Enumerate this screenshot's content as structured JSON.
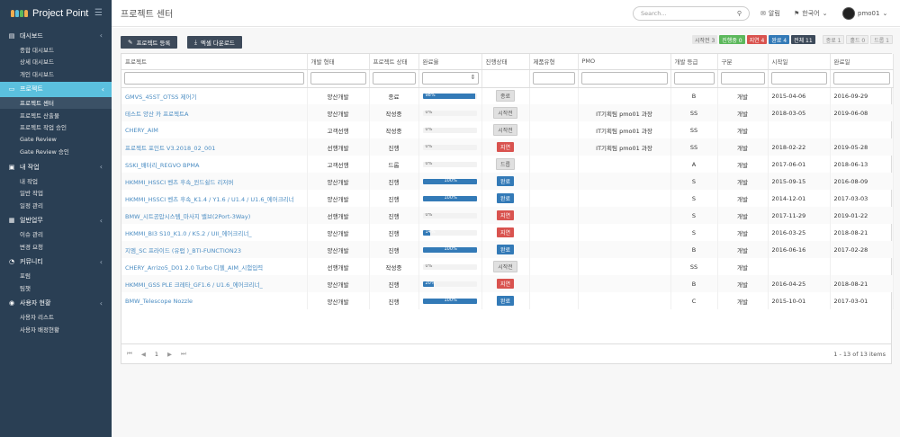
{
  "app": {
    "title": "Project Point"
  },
  "sidebar": {
    "sections": [
      {
        "label": "대시보드",
        "icon": "bar-chart-icon",
        "items": [
          "종합 대시보드",
          "상세 대시보드",
          "개인 대시보드"
        ]
      },
      {
        "label": "프로젝트",
        "icon": "monitor-icon",
        "items": [
          "프로젝트 센터",
          "프로젝트 산출물",
          "프로젝트 작업 승인",
          "Gate Review",
          "Gate Review 승인"
        ]
      },
      {
        "label": "내 작업",
        "icon": "briefcase-icon",
        "items": [
          "내 작업",
          "일반 작업",
          "일정 관리"
        ]
      },
      {
        "label": "일반업무",
        "icon": "calendar-icon",
        "items": [
          "이슈 관리",
          "변경 요청"
        ]
      },
      {
        "label": "커뮤니티",
        "icon": "chat-icon",
        "items": [
          "포럼",
          "팀챗"
        ]
      },
      {
        "label": "사용자 현황",
        "icon": "users-icon",
        "items": [
          "사용자 리스트",
          "사용자 배정현황"
        ]
      }
    ]
  },
  "header": {
    "page_title": "프로젝트 센터",
    "search_placeholder": "Search...",
    "notify_label": "알림",
    "language_label": "한국어",
    "user_label": "pmo01"
  },
  "toolbar": {
    "register_label": "프로젝트 등록",
    "excel_label": "엑셀 다운로드"
  },
  "status_badges": [
    {
      "label": "시작전 3",
      "bg": "#e6e6e6",
      "fg": "#666"
    },
    {
      "label": "진행중 0",
      "bg": "#5cb85c",
      "fg": "#fff"
    },
    {
      "label": "지연 4",
      "bg": "#d9534f",
      "fg": "#fff"
    },
    {
      "label": "완료 4",
      "bg": "#337ab7",
      "fg": "#fff"
    },
    {
      "label": "전체 11",
      "bg": "#3d4a5a",
      "fg": "#fff"
    }
  ],
  "gate_badges": [
    "종료 1",
    "홀드 0",
    "드롭 1"
  ],
  "columns": [
    "프로젝트",
    "개발 형태",
    "프로젝트 상태",
    "완료율",
    "진행상태",
    "제품유형",
    "PMO",
    "개발 등급",
    "구분",
    "시작일",
    "완료일"
  ],
  "rows": [
    {
      "name": "GMVS_45ST_OTSS 제어기",
      "dev": "양산개발",
      "pstate": "종료",
      "pct": 98,
      "status": "종료",
      "status_color": "gray",
      "pmo": "",
      "grade": "B",
      "type": "개발",
      "start": "2015-04-06",
      "end": "2016-09-29"
    },
    {
      "name": "테스트 양산 카 프로젝트A",
      "dev": "양산개발",
      "pstate": "작성중",
      "pct": 0,
      "status": "시작전",
      "status_color": "gray",
      "pmo": "IT기획팀 pmo01 과장",
      "grade": "SS",
      "type": "개발",
      "start": "2018-03-05",
      "end": "2019-06-08"
    },
    {
      "name": "CHERY_AIM",
      "dev": "고객선행",
      "pstate": "작성중",
      "pct": 0,
      "status": "시작전",
      "status_color": "gray",
      "pmo": "IT기획팀 pmo01 과장",
      "grade": "SS",
      "type": "개발",
      "start": "",
      "end": ""
    },
    {
      "name": "프로젝트 포인트 V3.2018_02_001",
      "dev": "선행개발",
      "pstate": "진행",
      "pct": 0,
      "status": "지연",
      "status_color": "red",
      "pmo": "IT기획팀 pmo01 과장",
      "grade": "SS",
      "type": "개발",
      "start": "2018-02-22",
      "end": "2019-05-28"
    },
    {
      "name": "SSKI_배터리_REGVO BPMA",
      "dev": "고객선행",
      "pstate": "드롭",
      "pct": 0,
      "status": "드롭",
      "status_color": "gray",
      "pmo": "",
      "grade": "A",
      "type": "개발",
      "start": "2017-06-01",
      "end": "2018-06-13"
    },
    {
      "name": "HKMMI_HSSCI 벤츠 후속_윈드쉴드 리저버",
      "dev": "양산개발",
      "pstate": "진행",
      "pct": 100,
      "status": "완료",
      "status_color": "blue",
      "pmo": "",
      "grade": "S",
      "type": "개발",
      "start": "2015-09-15",
      "end": "2016-08-09"
    },
    {
      "name": "HKMMI_HSSCI 벤츠 후속_K1.4 / Y1.6 / U1.4 / U1.6_에어크리너",
      "dev": "양산개발",
      "pstate": "진행",
      "pct": 100,
      "status": "완료",
      "status_color": "blue",
      "pmo": "",
      "grade": "S",
      "type": "개발",
      "start": "2014-12-01",
      "end": "2017-03-03"
    },
    {
      "name": "BMW_시트공압시스템_마사지 밸브(2Port-3Way)",
      "dev": "선행개발",
      "pstate": "진행",
      "pct": 0,
      "status": "지연",
      "status_color": "red",
      "pmo": "",
      "grade": "S",
      "type": "개발",
      "start": "2017-11-29",
      "end": "2019-01-22"
    },
    {
      "name": "HKMMI_BI3 S10_K1.0 / K5.2 / UII_에어크리너_",
      "dev": "양산개발",
      "pstate": "진행",
      "pct": 14,
      "status": "지연",
      "status_color": "red",
      "pmo": "",
      "grade": "S",
      "type": "개발",
      "start": "2016-03-25",
      "end": "2018-08-21"
    },
    {
      "name": "지엠_SC 프라이드 (유럽 )_BTI-FUNCTION23",
      "dev": "양산개발",
      "pstate": "진행",
      "pct": 100,
      "status": "완료",
      "status_color": "blue",
      "pmo": "",
      "grade": "B",
      "type": "개발",
      "start": "2016-06-16",
      "end": "2017-02-28"
    },
    {
      "name": "CHERY_Arrizo5_D01 2.0 Turbo 디젤_AIM_시험입력",
      "dev": "선행개발",
      "pstate": "작성중",
      "pct": 0,
      "status": "시작전",
      "status_color": "gray",
      "pmo": "",
      "grade": "SS",
      "type": "개발",
      "start": "",
      "end": ""
    },
    {
      "name": "HKMMI_GSS PLE 크레타_GF1.6 / U1.6_에어크리너_",
      "dev": "양산개발",
      "pstate": "진행",
      "pct": 20,
      "status": "지연",
      "status_color": "red",
      "pmo": "",
      "grade": "B",
      "type": "개발",
      "start": "2016-04-25",
      "end": "2018-08-21"
    },
    {
      "name": "BMW_Telescope Nozzle",
      "dev": "양산개발",
      "pstate": "진행",
      "pct": 100,
      "status": "완료",
      "status_color": "blue",
      "pmo": "",
      "grade": "C",
      "type": "개발",
      "start": "2015-10-01",
      "end": "2017-03-01"
    }
  ],
  "pager": {
    "page": "1",
    "info": "1 - 13 of 13 items"
  }
}
